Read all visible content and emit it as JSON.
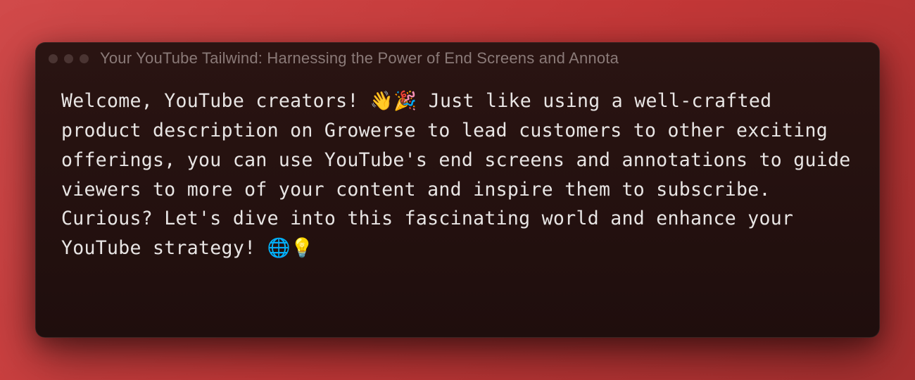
{
  "window": {
    "title": "Your YouTube Tailwind: Harnessing the Power of End Screens and Annota",
    "body": "Welcome, YouTube creators! 👋🎉 Just like using a well-crafted product description on Growerse to lead customers to other exciting offerings, you can use YouTube's end screens and annotations to guide viewers to more of your content and inspire them to subscribe. Curious? Let's dive into this fascinating world and enhance your YouTube strategy! 🌐💡"
  }
}
